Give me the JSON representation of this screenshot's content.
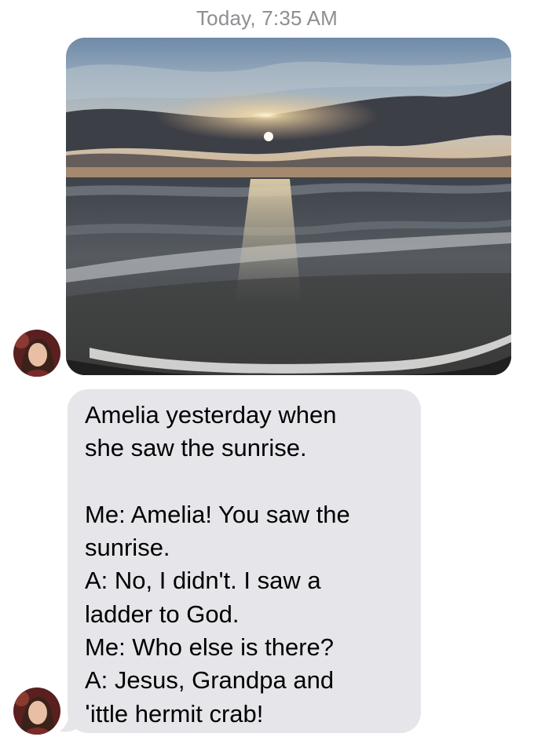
{
  "conversation": {
    "timestamp": "Today, 7:35 AM",
    "messages": [
      {
        "type": "image",
        "sender": "contact",
        "image_description": "ocean-sunrise-photo"
      },
      {
        "type": "text",
        "sender": "contact",
        "text": "Amelia yesterday when\nshe saw the sunrise.\n\nMe: Amelia! You saw the\nsunrise.\nA: No, I didn't. I saw a\nladder to God.\nMe: Who else is there?\nA: Jesus, Grandpa and\nlittle hermit crab!"
      }
    ]
  },
  "colors": {
    "bubble_incoming": "#e5e5ea",
    "timestamp_text": "#8e8e93",
    "background": "#ffffff"
  },
  "icons": {
    "avatar": "contact-avatar-photo"
  }
}
